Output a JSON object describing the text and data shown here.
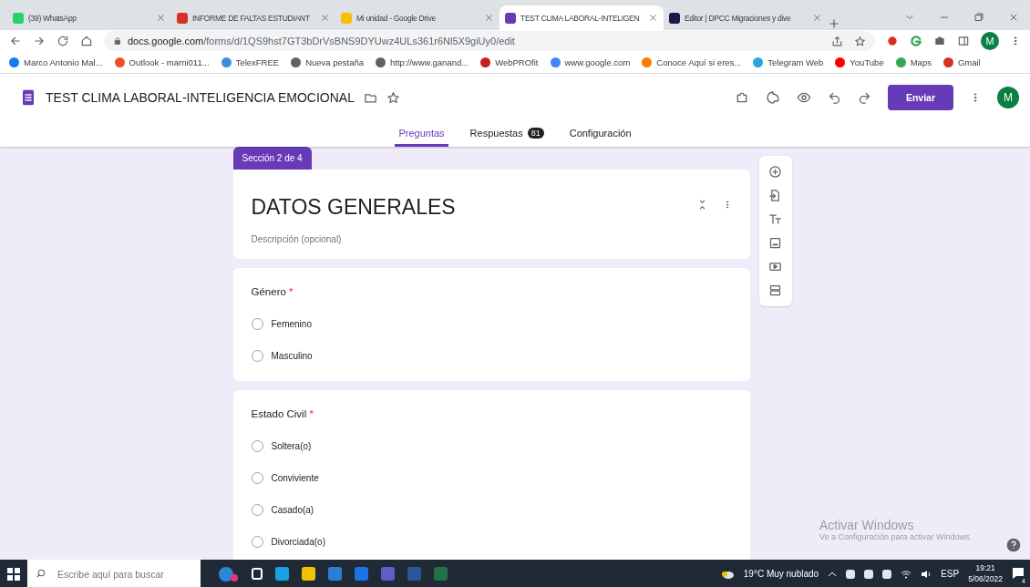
{
  "browser": {
    "tabs": [
      {
        "title": "(39) WhatsApp",
        "color": "#25d366",
        "selected": false
      },
      {
        "title": "INFORME DE FALTAS ESTUDIANT",
        "color": "#d93025",
        "selected": false
      },
      {
        "title": "Mi unidad - Google Drive",
        "color": "#fbbc04",
        "selected": false
      },
      {
        "title": "TEST CLIMA LABORAL-INTELIGEN",
        "color": "#673ab7",
        "selected": true
      },
      {
        "title": "Editor | DPCC Migraciones y dive",
        "color": "#1a1a4a",
        "selected": false
      }
    ],
    "url_host": "docs.google.com",
    "url_path": "/forms/d/1QS9hst7GT3bDrVsBNS9DYUwz4ULs361r6Nl5X9giUy0/edit",
    "avatar": "M",
    "bookmarks": [
      {
        "label": "Marco Antonio Mal...",
        "color": "#1877f2"
      },
      {
        "label": "Outlook - marni011...",
        "color": "#f25022"
      },
      {
        "label": "TelexFREE",
        "color": "#3b8fd9"
      },
      {
        "label": "Nueva pestaña",
        "color": "#5f6368"
      },
      {
        "label": "http://www.ganand...",
        "color": "#5f6368"
      },
      {
        "label": "WebPROfit",
        "color": "#c5221f"
      },
      {
        "label": "www.google.com",
        "color": "#4285f4"
      },
      {
        "label": "Conoce Aquí si eres...",
        "color": "#f57c00"
      },
      {
        "label": "Telegram Web",
        "color": "#2aa3df"
      },
      {
        "label": "YouTube",
        "color": "#ff0000"
      },
      {
        "label": "Maps",
        "color": "#34a853"
      },
      {
        "label": "Gmail",
        "color": "#d93025"
      }
    ]
  },
  "form": {
    "title": "TEST CLIMA LABORAL-INTELIGENCIA EMOCIONAL",
    "send_button": "Enviar",
    "avatar": "M",
    "tabs": [
      {
        "label": "Preguntas",
        "selected": true
      },
      {
        "label": "Respuestas",
        "badge": "81",
        "selected": false
      },
      {
        "label": "Configuración",
        "selected": false
      }
    ],
    "section_badge": "Sección 2 de 4",
    "section_title": "DATOS GENERALES",
    "description_placeholder": "Descripción (opcional)",
    "questions": [
      {
        "title": "Género",
        "required_mark": "*",
        "options": [
          {
            "label": "Femenino",
            "checked": false
          },
          {
            "label": "Masculino",
            "checked": false
          }
        ]
      },
      {
        "title": "Estado Civil",
        "required_mark": "*",
        "options": [
          {
            "label": "Soltera(o)",
            "checked": false
          },
          {
            "label": "Conviviente",
            "checked": false
          },
          {
            "label": "Casado(a)",
            "checked": false
          },
          {
            "label": "Divorciada(o)",
            "checked": false
          }
        ]
      }
    ]
  },
  "activation": {
    "title": "Activar Windows",
    "subtitle": "Ve a Configuración para activar Windows."
  },
  "taskbar": {
    "search_placeholder": "Escribe aquí para buscar",
    "weather": "19°C  Muy nublado",
    "language": "ESP",
    "time": "19:21",
    "date": "5/06/2022",
    "notification_count": "4"
  }
}
